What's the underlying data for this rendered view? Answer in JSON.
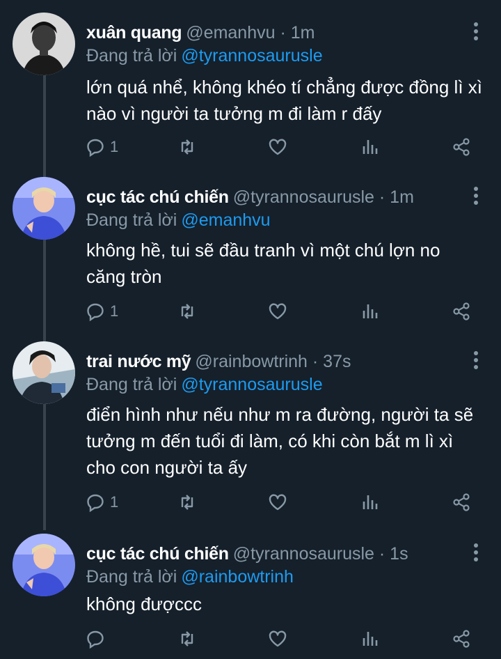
{
  "tweets": [
    {
      "name": "xuân quang",
      "meta": "@emanhvu · 1m",
      "reply_label": "Đang trả lời",
      "reply_to": "@tyrannosaurusle",
      "lines": [
        "lớn quá nhể, không khéo tí chẳng được đồng lì xì",
        "nào vì người ta tưởng m đi làm r đấy"
      ],
      "reply_count": "1"
    },
    {
      "name": "cục tác chú chiến",
      "meta": "@tyrannosaurusle · 1m",
      "reply_label": "Đang trả lời",
      "reply_to": "@emanhvu",
      "lines": [
        "không hề, tui sẽ đầu tranh vì một chú lợn no",
        "căng tròn"
      ],
      "reply_count": "1"
    },
    {
      "name": "trai nước mỹ",
      "meta": "@rainbowtrinh · 37s",
      "reply_label": "Đang trả lời",
      "reply_to": "@tyrannosaurusle",
      "lines": [
        "điển hình như nếu như m ra đường, người ta sẽ",
        "tưởng m đến tuổi đi làm, có khi còn bắt m lì xì",
        "cho con người ta ấy"
      ],
      "reply_count": "1"
    },
    {
      "name": "cục tác chú chiến",
      "meta": "@tyrannosaurusle · 1s",
      "reply_label": "Đang trả lời",
      "reply_to": "@rainbowtrinh",
      "lines": [
        "không đượccc"
      ],
      "reply_count": ""
    }
  ],
  "icons": {
    "reply": "reply-icon",
    "retweet": "retweet-icon",
    "like": "heart-icon",
    "analytics": "analytics-icon",
    "share": "share-icon",
    "more": "more-vertical-icon"
  },
  "colors": {
    "background": "#15202b",
    "muted": "#8899a6",
    "mention": "#1d9bf0",
    "thread_line": "#38444d"
  }
}
